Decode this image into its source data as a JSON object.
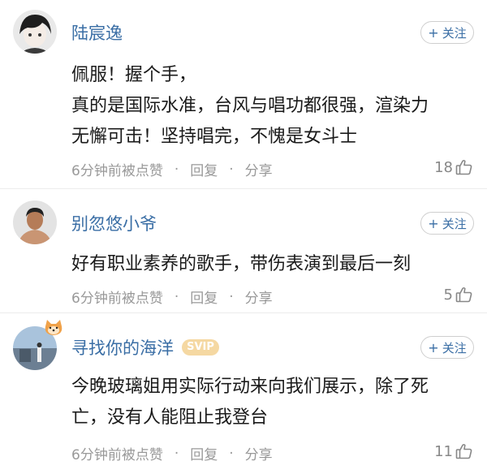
{
  "comments": [
    {
      "username": "陆宸逸",
      "follow_label": "关注",
      "body_lines": [
        "佩服！握个手，",
        "真的是国际水准，台风与唱功都很强，渲染力",
        "无懈可击！坚持唱完，不愧是女斗士"
      ],
      "time_label": "6分钟前被点赞",
      "reply_label": "回复",
      "share_label": "分享",
      "likes": "18"
    },
    {
      "username": "别忽悠小爷",
      "follow_label": "关注",
      "body_lines": [
        "好有职业素养的歌手，带伤表演到最后一刻"
      ],
      "time_label": "6分钟前被点赞",
      "reply_label": "回复",
      "share_label": "分享",
      "likes": "5"
    },
    {
      "username": "寻找你的海洋",
      "badge": "SVIP",
      "follow_label": "关注",
      "body_lines": [
        "今晚玻璃姐用实际行动来向我们展示，除了死",
        "亡，没有人能阻止我登台"
      ],
      "time_label": "6分钟前被点赞",
      "reply_label": "回复",
      "share_label": "分享",
      "likes": "11"
    }
  ],
  "meta_separator": "·",
  "colors": {
    "link": "#3a6ea5",
    "meta": "#999999",
    "badge": "#f5d8a2"
  }
}
